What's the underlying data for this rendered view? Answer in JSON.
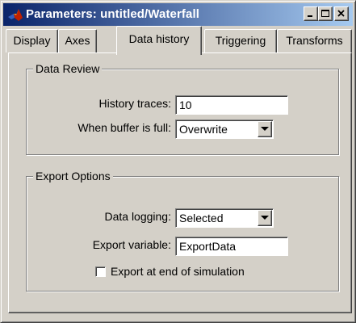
{
  "window": {
    "title": "Parameters: untitled/Waterfall",
    "app_icon": "matlab-logo-icon",
    "buttons": [
      "minimize-icon",
      "maximize-icon",
      "close-icon"
    ],
    "titlebar_colors": [
      "#0a246a",
      "#a6caf0"
    ]
  },
  "tabs": [
    {
      "label": "Display",
      "active": false
    },
    {
      "label": "Axes",
      "active": false
    },
    {
      "label": "Data history",
      "active": true
    },
    {
      "label": "Triggering",
      "active": false
    },
    {
      "label": "Transforms",
      "active": false
    }
  ],
  "data_review": {
    "legend": "Data Review",
    "history_traces_label": "History traces:",
    "history_traces_value": "10",
    "buffer_label": "When buffer is full:",
    "buffer_value": "Overwrite"
  },
  "export_options": {
    "legend": "Export Options",
    "logging_label": "Data logging:",
    "logging_value": "Selected",
    "variable_label": "Export variable:",
    "variable_value": "ExportData",
    "checkbox_label": "Export at end of simulation",
    "checkbox_checked": false
  }
}
